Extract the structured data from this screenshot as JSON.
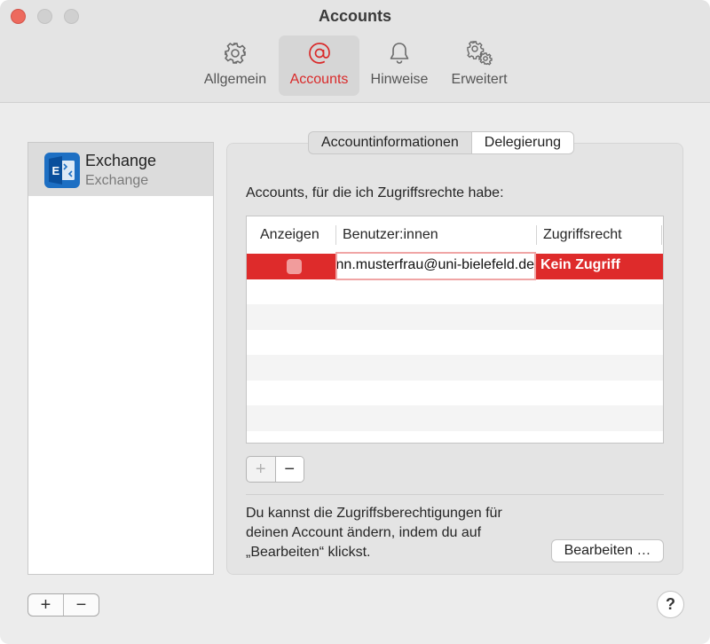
{
  "window": {
    "title": "Accounts"
  },
  "toolbar": {
    "items": [
      {
        "label": "Allgemein",
        "icon": "gear-icon"
      },
      {
        "label": "Accounts",
        "icon": "at-sign-icon",
        "active": true
      },
      {
        "label": "Hinweise",
        "icon": "bell-icon"
      },
      {
        "label": "Erweitert",
        "icon": "gears-icon"
      }
    ],
    "accent_color": "#d92a2a"
  },
  "sidebar": {
    "accounts": [
      {
        "name": "Exchange",
        "type": "Exchange",
        "icon": "exchange-icon"
      }
    ],
    "add_label": "+",
    "remove_label": "−"
  },
  "tabs": {
    "items": [
      "Accountinformationen",
      "Delegierung"
    ],
    "active": "Delegierung"
  },
  "delegation": {
    "section_label": "Accounts, für die ich Zugriffsrechte habe:",
    "columns": [
      "Anzeigen",
      "Benutzer:innen",
      "Zugriffsrecht"
    ],
    "rows": [
      {
        "anzeigen": false,
        "user": "mustermann.musterfrau@uni-bielefeld.de",
        "access": "Kein Zugriff"
      }
    ],
    "selection_color": "#de2b2b",
    "add_label": "+",
    "remove_label": "−",
    "info_lines": [
      "Du kannst die Zugriffsberechtigungen für",
      "deinen Account ändern, indem du auf",
      "„Bearbeiten“ klickst."
    ],
    "edit_button": "Bearbeiten …"
  },
  "help": {
    "label": "?"
  }
}
